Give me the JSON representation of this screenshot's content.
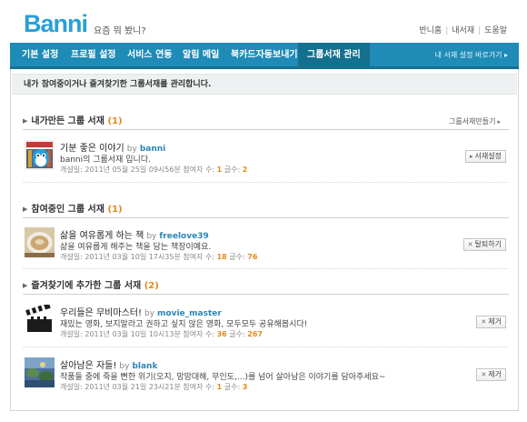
{
  "header": {
    "logo": "Banni",
    "tagline": "요즘 뭐 봤니?",
    "links": [
      "반니홈",
      "내서재",
      "도움말"
    ]
  },
  "nav": {
    "tabs": [
      "기본 설정",
      "프로필 설정",
      "서비스 연동",
      "알림 메일",
      "북카드자동보내기",
      "그룹서재 관리"
    ],
    "right_link": "내 서재 설정 바로가기 ▸"
  },
  "notice": "내가 참여중이거나 즐겨찾기한 그룹서재를 관리합니다.",
  "sections": {
    "mine": {
      "title": "내가만든 그룹 서재",
      "count": "(1)",
      "button": "그룹서재만들기",
      "items": [
        {
          "title": "기분 좋은 이야기",
          "by": "by",
          "owner": "banni",
          "desc": "banni의 그룹서재 입니다.",
          "meta": "개설일: 2011년 05월 25일 09시56분  참여자 수:",
          "members": "1",
          "posts_label": "글수:",
          "posts": "2",
          "button": "서재설정"
        }
      ]
    },
    "joined": {
      "title": "참여중인 그룹 서재",
      "count": "(1)",
      "items": [
        {
          "title": "삶을 여유롭게 하는 책",
          "by": "by",
          "owner": "freelove39",
          "desc": "삶을 여유롭게 해주는 책을 담는 책장이예요.",
          "meta": "개설일: 2011년 03월 10일 17시35분  참여자 수:",
          "members": "18",
          "posts_label": "글수:",
          "posts": "76",
          "button": "탈퇴하기"
        }
      ]
    },
    "favorites": {
      "title": "즐겨찾기에 추가한 그룹 서재",
      "count": "(2)",
      "items": [
        {
          "title": "우리들은 무비마스터!",
          "by": "by",
          "owner": "movie_master",
          "desc": "재밌는 영화, 보지말라고 권하고 싶지 않은 영화, 모두모두 공유해봅시다!",
          "meta": "개설일: 2011년 03월 10일 10시13분  참여자 수:",
          "members": "36",
          "posts_label": "글수:",
          "posts": "267",
          "button": "제거"
        },
        {
          "title": "살아남은 자들!",
          "by": "by",
          "owner": "blank",
          "desc": "작품들 중에 죽을 뻔한 위기(오지, 망망대해, 무인도,...)를 넘어 살아남은 이야기를 담아주세요~",
          "meta": "개설일: 2011년 03월 21일 23시21분  참여자 수:",
          "members": "1",
          "posts_label": "글수:",
          "posts": "3",
          "button": "제거"
        }
      ]
    }
  },
  "colors": {
    "brand": "#2a9fd8",
    "nav": "#1f8bb7",
    "accent": "#e38a14",
    "link": "#2a86b6"
  },
  "icons": {
    "section_arrow": "triangle-right-icon",
    "remove": "x-icon"
  }
}
